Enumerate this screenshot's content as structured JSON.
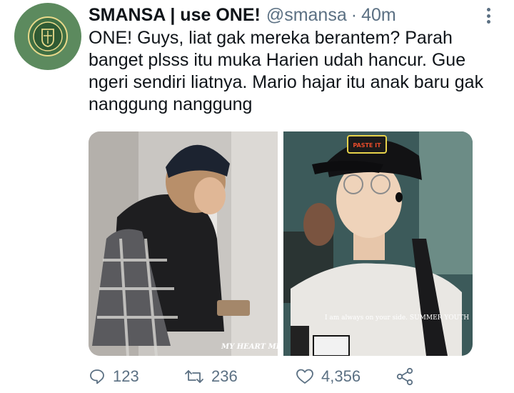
{
  "tweet": {
    "display_name": "SMANSA | use ONE!",
    "handle": "@smansa",
    "separator": "·",
    "time": "40m",
    "text": "ONE! Guys, liat gak mereka berantem? Parah banget plsss itu muka Harien udah hancur. Gue ngeri sendiri liatnya. Mario hajar itu anak baru gak nanggung nanggung"
  },
  "media": {
    "left_caption": "MY HEART MEL",
    "right_caption": "I am always on your side. SUMMER YOUTH",
    "cap_text": "PASTE IT"
  },
  "actions": {
    "replies": "123",
    "retweets": "236",
    "likes": "4,356"
  },
  "icons": {
    "avatar": "school-crest-icon",
    "more": "more-vertical-icon",
    "reply": "reply-icon",
    "retweet": "retweet-icon",
    "like": "heart-icon",
    "share": "share-icon"
  },
  "colors": {
    "text": "#0f1419",
    "secondary": "#5b7083",
    "avatar_bg": "#5c8a5e"
  }
}
